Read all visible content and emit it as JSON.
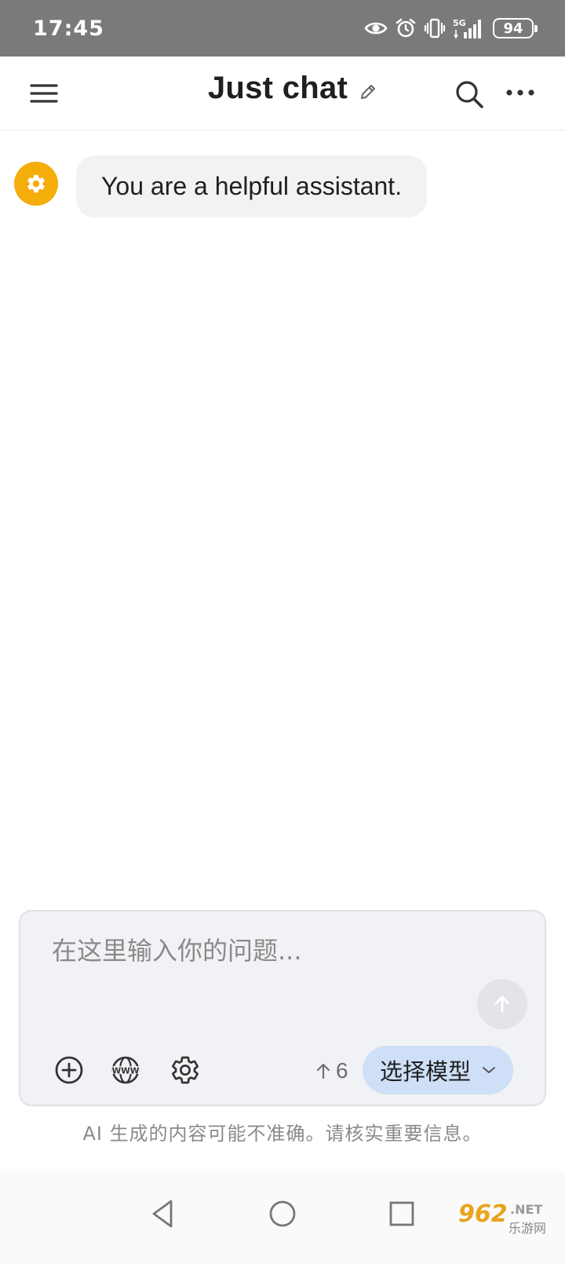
{
  "status_bar": {
    "time": "17:45",
    "network_label": "5G",
    "battery_level": "94",
    "icons": [
      "eye-icon",
      "alarm-icon",
      "vibrate-icon",
      "signal-5g-icon",
      "battery-icon"
    ]
  },
  "header": {
    "title": "Just chat",
    "icons": [
      "menu-icon",
      "edit-pencil-icon",
      "search-icon",
      "more-horizontal-icon"
    ]
  },
  "messages": [
    {
      "role": "system",
      "icon": "gear-icon",
      "text": "You are a helpful assistant."
    }
  ],
  "composer": {
    "placeholder": "在这里输入你的问题...",
    "value": "",
    "token_count": "6",
    "model_button_label": "选择模型",
    "icons": [
      "add-circle-icon",
      "www-globe-icon",
      "settings-gear-icon",
      "arrow-up-icon",
      "chevron-down-icon",
      "send-arrow-icon"
    ]
  },
  "disclaimer": "AI 生成的内容可能不准确。请核实重要信息。",
  "nav_bar": {
    "icons": [
      "back-triangle-icon",
      "home-circle-icon",
      "recent-square-icon"
    ]
  },
  "watermark": {
    "text": "962.NET",
    "sub_text": "乐游网"
  },
  "colors": {
    "status_bar_bg": "#7a7a7a",
    "avatar_accent": "#f5ad0c",
    "bubble_bg": "#f1f2f4",
    "composer_bg": "#f1f2f5",
    "model_button_bg": "#cfdff7",
    "text_primary": "#1f1f1f",
    "text_muted": "#8a8a8a"
  }
}
